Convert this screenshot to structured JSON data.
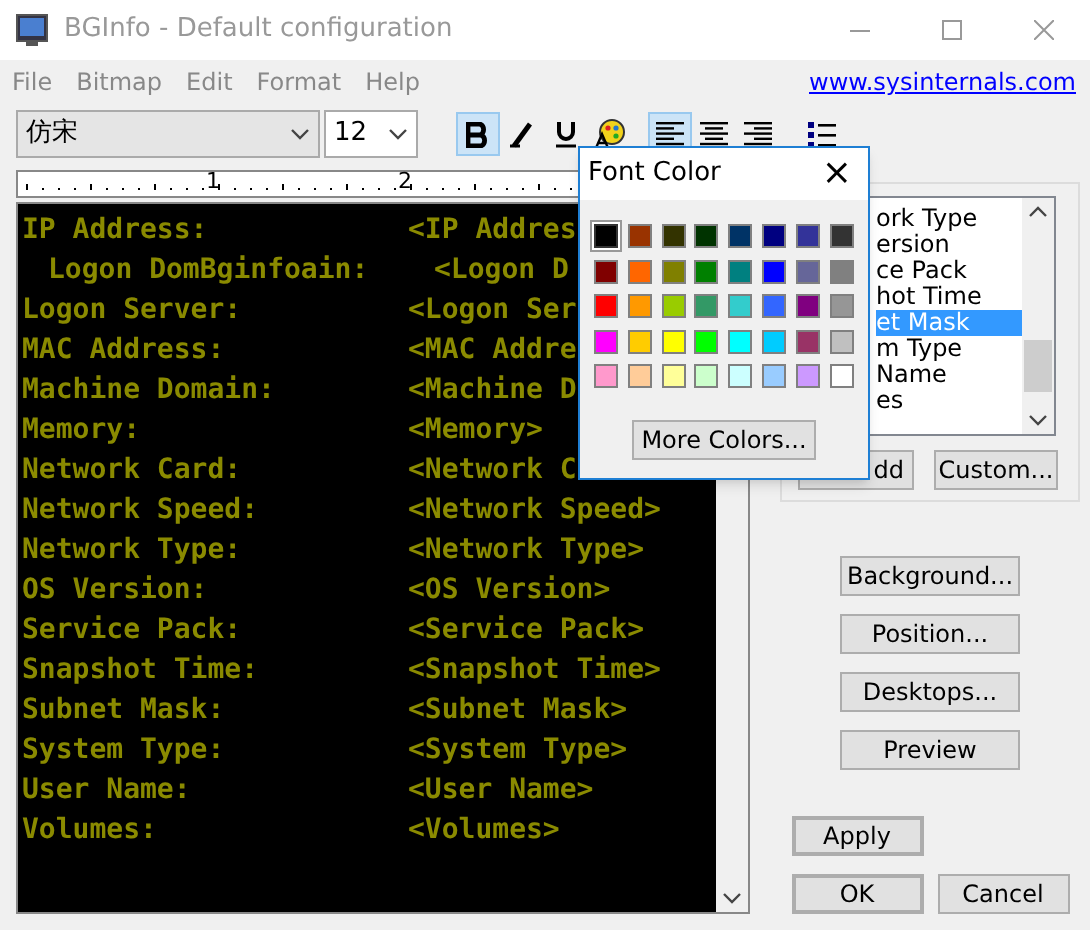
{
  "window": {
    "title": "BGInfo - Default configuration"
  },
  "menu": [
    "File",
    "Bitmap",
    "Edit",
    "Format",
    "Help"
  ],
  "link": "www.sysinternals.com",
  "toolbar": {
    "font": "仿宋",
    "size": "12",
    "buttons": [
      {
        "kind": "bold",
        "selected": true
      },
      {
        "kind": "italic",
        "selected": false
      },
      {
        "kind": "underline",
        "selected": false
      },
      {
        "kind": "color",
        "selected": false
      },
      {
        "kind": "align-left",
        "selected": true
      },
      {
        "kind": "align-center",
        "selected": false
      },
      {
        "kind": "align-right",
        "selected": false
      },
      {
        "kind": "bullets",
        "selected": false
      }
    ]
  },
  "ruler": {
    "labels": [
      "1",
      "2"
    ]
  },
  "editor": {
    "lines": [
      {
        "label": "IP Address:",
        "value": "<IP Addres",
        "indented": false
      },
      {
        "label": "Logon DomBginfoain:",
        "value": "<Logon D",
        "indented": true
      },
      {
        "label": "Logon Server:",
        "value": "<Logon Ser",
        "indented": false
      },
      {
        "label": "MAC Address:",
        "value": "<MAC Addre",
        "indented": false
      },
      {
        "label": "Machine Domain:",
        "value": "<Machine D",
        "indented": false
      },
      {
        "label": "Memory:",
        "value": "<Memory>",
        "indented": false
      },
      {
        "label": "Network Card:",
        "value": "<Network C",
        "indented": false
      },
      {
        "label": "Network Speed:",
        "value": "<Network Speed>",
        "indented": false
      },
      {
        "label": "Network Type:",
        "value": "<Network Type>",
        "indented": false
      },
      {
        "label": "OS Version:",
        "value": "<OS Version>",
        "indented": false
      },
      {
        "label": "Service Pack:",
        "value": "<Service Pack>",
        "indented": false
      },
      {
        "label": "Snapshot Time:",
        "value": "<Snapshot Time>",
        "indented": false
      },
      {
        "label": "Subnet Mask:",
        "value": "<Subnet Mask>",
        "indented": false
      },
      {
        "label": "System Type:",
        "value": "<System Type>",
        "indented": false
      },
      {
        "label": "User Name:",
        "value": "<User Name>",
        "indented": false
      },
      {
        "label": "Volumes:",
        "value": "<Volumes>",
        "indented": false
      }
    ]
  },
  "fields_list": {
    "items": [
      {
        "label": "ork Type",
        "selected": false
      },
      {
        "label": "ersion",
        "selected": false
      },
      {
        "label": "ce Pack",
        "selected": false
      },
      {
        "label": "hot Time",
        "selected": false
      },
      {
        "label": "et Mask",
        "selected": true
      },
      {
        "label": "m Type",
        "selected": false
      },
      {
        "label": "Name",
        "selected": false
      },
      {
        "label": "es",
        "selected": false
      }
    ],
    "add_button": "dd",
    "custom_button": "Custom..."
  },
  "side_buttons": [
    "Background...",
    "Position...",
    "Desktops...",
    "Preview"
  ],
  "dialog_buttons": [
    {
      "label": "Apply",
      "default": true
    },
    {
      "label": "OK",
      "default": true
    },
    {
      "label": "Cancel",
      "default": false
    }
  ],
  "font_color_popup": {
    "title": "Font Color",
    "close": "×",
    "more_button": "More Colors...",
    "swatches": [
      {
        "color": "#000000",
        "selected": true
      },
      {
        "color": "#993300",
        "selected": false
      },
      {
        "color": "#333300",
        "selected": false
      },
      {
        "color": "#003300",
        "selected": false
      },
      {
        "color": "#003366",
        "selected": false
      },
      {
        "color": "#000080",
        "selected": false
      },
      {
        "color": "#333399",
        "selected": false
      },
      {
        "color": "#333333",
        "selected": false
      },
      {
        "color": "#800000",
        "selected": false
      },
      {
        "color": "#ff6600",
        "selected": false
      },
      {
        "color": "#808000",
        "selected": false
      },
      {
        "color": "#008000",
        "selected": false
      },
      {
        "color": "#008080",
        "selected": false
      },
      {
        "color": "#0000ff",
        "selected": false
      },
      {
        "color": "#666699",
        "selected": false
      },
      {
        "color": "#808080",
        "selected": false
      },
      {
        "color": "#ff0000",
        "selected": false
      },
      {
        "color": "#ff9900",
        "selected": false
      },
      {
        "color": "#99cc00",
        "selected": false
      },
      {
        "color": "#339966",
        "selected": false
      },
      {
        "color": "#33cccc",
        "selected": false
      },
      {
        "color": "#3366ff",
        "selected": false
      },
      {
        "color": "#800080",
        "selected": false
      },
      {
        "color": "#969696",
        "selected": false
      },
      {
        "color": "#ff00ff",
        "selected": false
      },
      {
        "color": "#ffcc00",
        "selected": false
      },
      {
        "color": "#ffff00",
        "selected": false
      },
      {
        "color": "#00ff00",
        "selected": false
      },
      {
        "color": "#00ffff",
        "selected": false
      },
      {
        "color": "#00ccff",
        "selected": false
      },
      {
        "color": "#993366",
        "selected": false
      },
      {
        "color": "#c0c0c0",
        "selected": false
      },
      {
        "color": "#ff99cc",
        "selected": false
      },
      {
        "color": "#ffcc99",
        "selected": false
      },
      {
        "color": "#ffff99",
        "selected": false
      },
      {
        "color": "#ccffcc",
        "selected": false
      },
      {
        "color": "#ccffff",
        "selected": false
      },
      {
        "color": "#99ccff",
        "selected": false
      },
      {
        "color": "#cc99ff",
        "selected": false
      },
      {
        "color": "#ffffff",
        "selected": false
      }
    ]
  }
}
